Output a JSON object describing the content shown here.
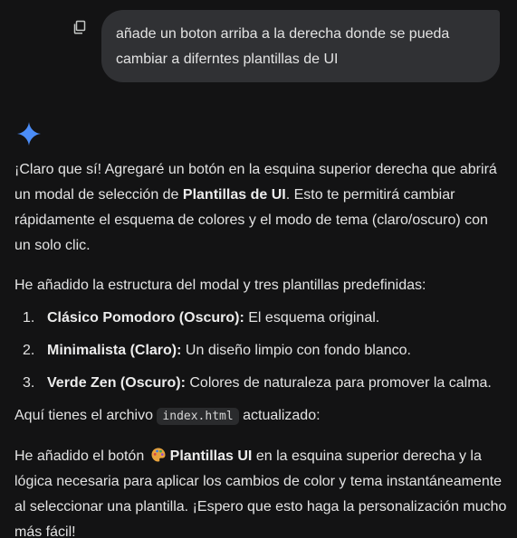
{
  "user_message": {
    "text": "añade un boton arriba a la derecha donde se pueda cambiar a diferntes plantillas de UI",
    "copy_icon": "copy-icon"
  },
  "assistant": {
    "icon": "sparkle-icon",
    "intro": {
      "before": "¡Claro que sí! Agregaré un botón en la esquina superior derecha que abrirá un modal de selección de ",
      "bold": "Plantillas de UI",
      "after": ". Esto te permitirá cambiar rápidamente el esquema de colores y el modo de tema (claro/oscuro) con un solo clic."
    },
    "list_intro": "He añadido la estructura del modal y tres plantillas predefinidas:",
    "templates": [
      {
        "number": "1.",
        "name": "Clásico Pomodoro (Oscuro):",
        "desc": " El esquema original."
      },
      {
        "number": "2.",
        "name": "Minimalista (Claro):",
        "desc": " Un diseño limpio con fondo blanco."
      },
      {
        "number": "3.",
        "name": "Verde Zen (Oscuro):",
        "desc": " Colores de naturaleza para promover la calma."
      }
    ],
    "file_line": {
      "before": "Aquí tienes el archivo ",
      "code": "index.html",
      "after": " actualizado:"
    },
    "final": {
      "before": "He añadido el botón ",
      "emoji": "palette-icon",
      "bold": "Plantillas UI",
      "after": " en la esquina superior derecha y la lógica necesaria para aplicar los cambios de color y tema instantáneamente al seleccionar una plantilla. ¡Espero que esto haga la personalización mucho más fácil!"
    }
  },
  "colors": {
    "background": "#131314",
    "bubble": "#303134",
    "text": "#e3e3e3",
    "sparkle": "#4b8df8"
  }
}
